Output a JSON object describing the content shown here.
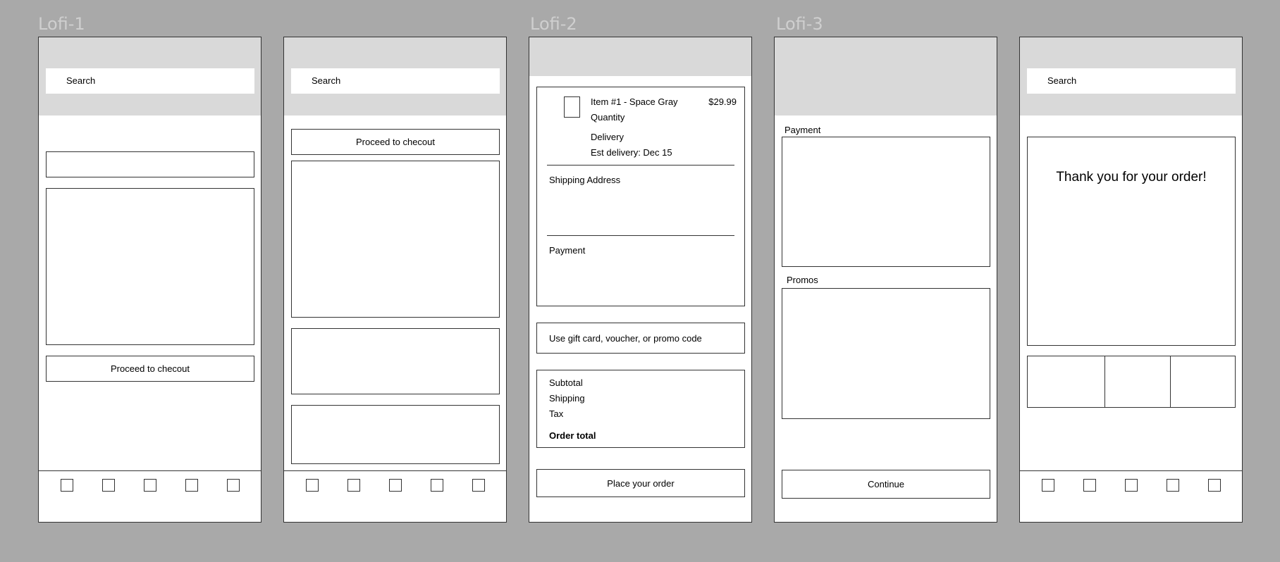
{
  "labels": {
    "lofi1": "Lofi-1",
    "lofi2": "Lofi-2",
    "lofi3": "Lofi-3"
  },
  "screen1": {
    "search_placeholder": "Search",
    "checkout_button": "Proceed to checout"
  },
  "screen2": {
    "search_placeholder": "Search",
    "checkout_button": "Proceed to checout"
  },
  "screen3": {
    "item": {
      "name": "Item #1 - Space Gray",
      "price": "$29.99",
      "quantity_label": "Quantity",
      "delivery_label": "Delivery",
      "est_delivery": "Est delivery: Dec 15"
    },
    "shipping_address_label": "Shipping Address",
    "payment_label": "Payment",
    "promo_field": "Use gift card, voucher, or promo code",
    "summary": {
      "subtotal": "Subtotal",
      "shipping": "Shipping",
      "tax": "Tax",
      "order_total": "Order total"
    },
    "place_order_button": "Place your order"
  },
  "screen4": {
    "payment_label": "Payment",
    "promos_label": "Promos",
    "continue_button": "Continue"
  },
  "screen5": {
    "search_placeholder": "Search",
    "thank_you_message": "Thank you for your order!"
  },
  "colors": {
    "canvas": "#a9a9a9",
    "header": "#d9d9d9",
    "frame_label": "#cfcfcf"
  }
}
